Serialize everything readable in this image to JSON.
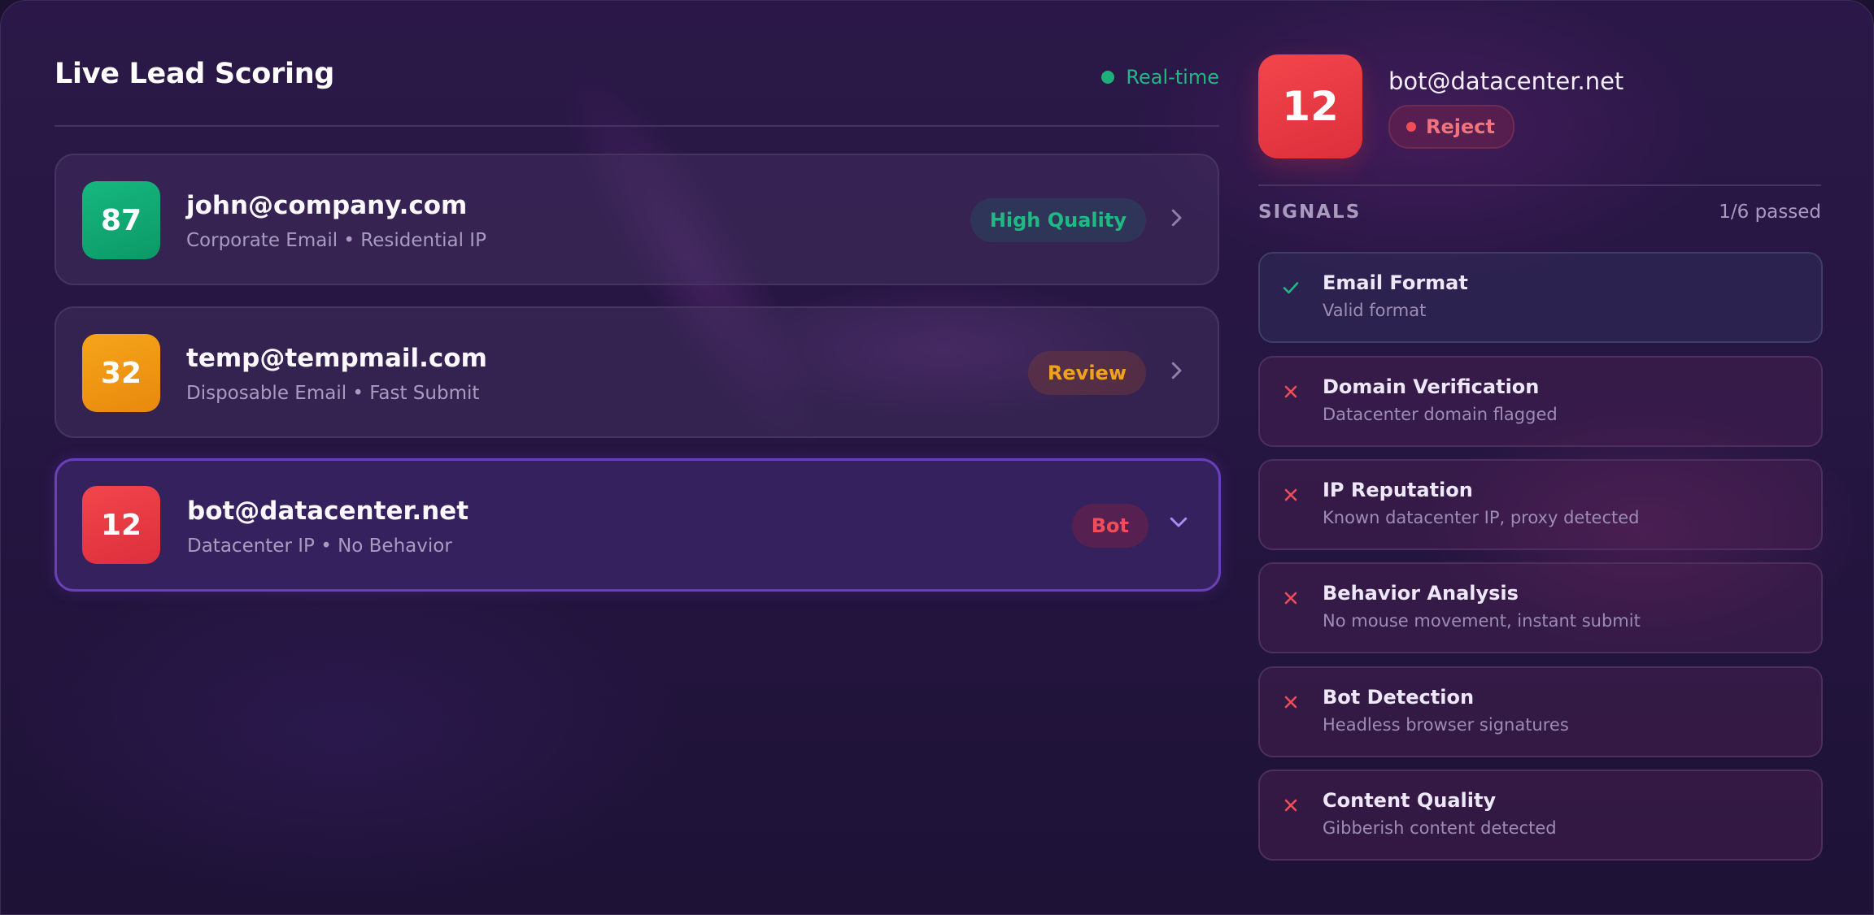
{
  "header": {
    "title": "Live Lead Scoring",
    "status_label": "Real-time",
    "status_color": "#1fae7a"
  },
  "leads": [
    {
      "score": "87",
      "email": "john@company.com",
      "tags": "Corporate Email • Residential IP",
      "badge": "High Quality",
      "badge_color": "#1fb983",
      "score_color": "#12a672",
      "state": "collapsed",
      "icon": "chevron-right-icon"
    },
    {
      "score": "32",
      "email": "temp@tempmail.com",
      "tags": "Disposable Email • Fast Submit",
      "badge": "Review",
      "badge_color": "#f0a21f",
      "score_color": "#ef9a12",
      "state": "collapsed",
      "icon": "chevron-right-icon"
    },
    {
      "score": "12",
      "email": "bot@datacenter.net",
      "tags": "Datacenter IP • No Behavior",
      "badge": "Bot",
      "badge_color": "#ef4e58",
      "score_color": "#ec3c45",
      "state": "expanded",
      "icon": "chevron-down-icon"
    }
  ],
  "detail": {
    "score": "12",
    "email": "bot@datacenter.net",
    "verdict": "Reject",
    "verdict_color": "#ef4e58",
    "signals_title": "SIGNALS",
    "signals_count": "1/6 passed",
    "signals": [
      {
        "name": "Email Format",
        "description": "Valid format",
        "status": "pass",
        "icon": "check-icon"
      },
      {
        "name": "Domain Verification",
        "description": "Datacenter domain flagged",
        "status": "fail",
        "icon": "x-icon"
      },
      {
        "name": "IP Reputation",
        "description": "Known datacenter IP, proxy detected",
        "status": "fail",
        "icon": "x-icon"
      },
      {
        "name": "Behavior Analysis",
        "description": "No mouse movement, instant submit",
        "status": "fail",
        "icon": "x-icon"
      },
      {
        "name": "Bot Detection",
        "description": "Headless browser signatures",
        "status": "fail",
        "icon": "x-icon"
      },
      {
        "name": "Content Quality",
        "description": "Gibberish content detected",
        "status": "fail",
        "icon": "x-icon"
      }
    ]
  }
}
